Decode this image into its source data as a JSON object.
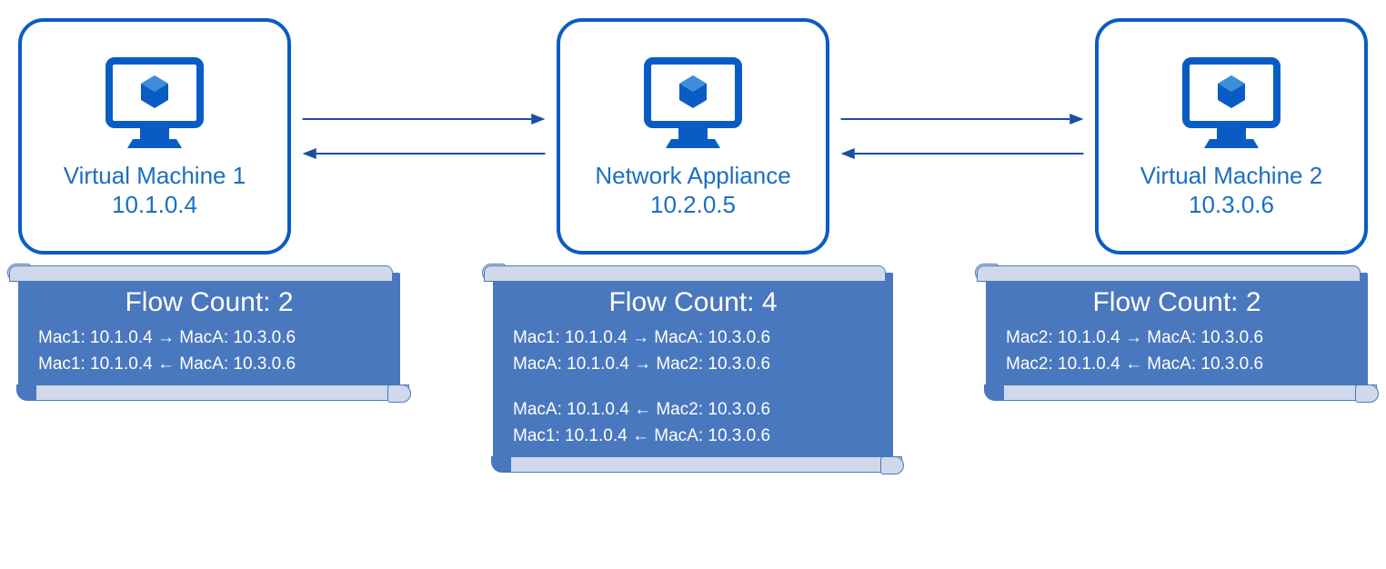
{
  "nodes": [
    {
      "title": "Virtual Machine 1",
      "ip": "10.1.0.4"
    },
    {
      "title": "Network Appliance",
      "ip": "10.2.0.5"
    },
    {
      "title": "Virtual Machine 2",
      "ip": "10.3.0.6"
    }
  ],
  "flows": [
    {
      "count_label": "Flow Count: 2",
      "lines": [
        "Mac1: 10.1.0.4 → MacA: 10.3.0.6",
        "Mac1: 10.1.0.4 ← MacA: 10.3.0.6"
      ]
    },
    {
      "count_label": "Flow Count: 4",
      "lines": [
        "Mac1: 10.1.0.4 → MacA: 10.3.0.6",
        "MacA: 10.1.0.4 → Mac2: 10.3.0.6",
        "",
        "MacA: 10.1.0.4 ← Mac2: 10.3.0.6",
        "Mac1: 10.1.0.4 ← MacA: 10.3.0.6"
      ]
    },
    {
      "count_label": "Flow Count: 2",
      "lines": [
        "Mac2: 10.1.0.4 → MacA: 10.3.0.6",
        "Mac2: 10.1.0.4 ← MacA: 10.3.0.6"
      ]
    }
  ],
  "colors": {
    "azure_blue": "#0a5cc5",
    "scroll_bg": "#4a78bf",
    "scroll_curl": "#cfd9ea"
  }
}
